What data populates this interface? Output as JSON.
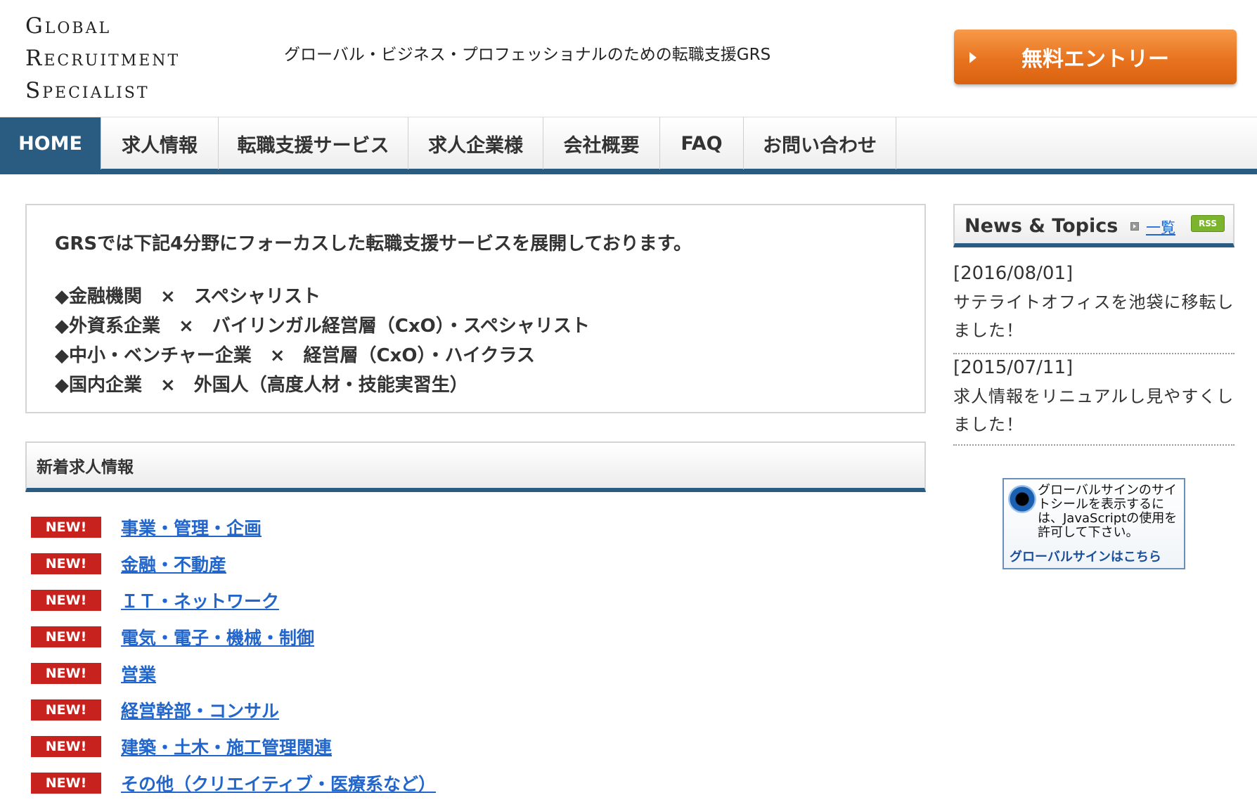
{
  "header": {
    "logo_lines": [
      "Global",
      "Recruitment",
      "Specialist"
    ],
    "tagline": "グローバル・ビジネス・プロフェッショナルのための転職支援GRS",
    "entry_button": "無料エントリー"
  },
  "nav": {
    "items": [
      "HOME",
      "求人情報",
      "転職支援サービス",
      "求人企業様",
      "会社概要",
      "FAQ",
      "お問い合わせ"
    ],
    "active": "HOME"
  },
  "intro": {
    "lead": "GRSでは下記4分野にフォーカスした転職支援サービスを展開しております。",
    "items": [
      "◆金融機関　×　スペシャリスト",
      "◆外資系企業　×　バイリンガル経営層（CxO）・スペシャリスト",
      "◆中小・ベンチャー企業　×　経営層（CxO）・ハイクラス",
      "◆国内企業　×　外国人（高度人材・技能実習生）"
    ]
  },
  "jobs": {
    "heading": "新着求人情報",
    "badge": "NEW!",
    "items": [
      "事業・管理・企画",
      "金融・不動産",
      "ＩＴ・ネットワーク",
      "電気・電子・機械・制御",
      "営業",
      "経営幹部・コンサル",
      "建築・土木・施工管理関連",
      "その他（クリエイティブ・医療系など）"
    ]
  },
  "news": {
    "title": "News & Topics",
    "list_link": "一覧",
    "rss": "RSS",
    "items": [
      {
        "date": "[2016/08/01]",
        "text": "サテライトオフィスを池袋に移転しました！"
      },
      {
        "date": "[2015/07/11]",
        "text": "求人情報をリニュアルし見やすくしました！"
      }
    ]
  },
  "seal": {
    "text": "グローバルサインのサイトシールを表示するには、JavaScriptの使用を許可して下さい。",
    "link": "グローバルサインはこちら"
  },
  "colors": {
    "nav_active": "#2a5b80",
    "entry_button": "#e8731f",
    "new_badge": "#c8221e",
    "link": "#2266cc",
    "rss": "#7cb52d"
  }
}
